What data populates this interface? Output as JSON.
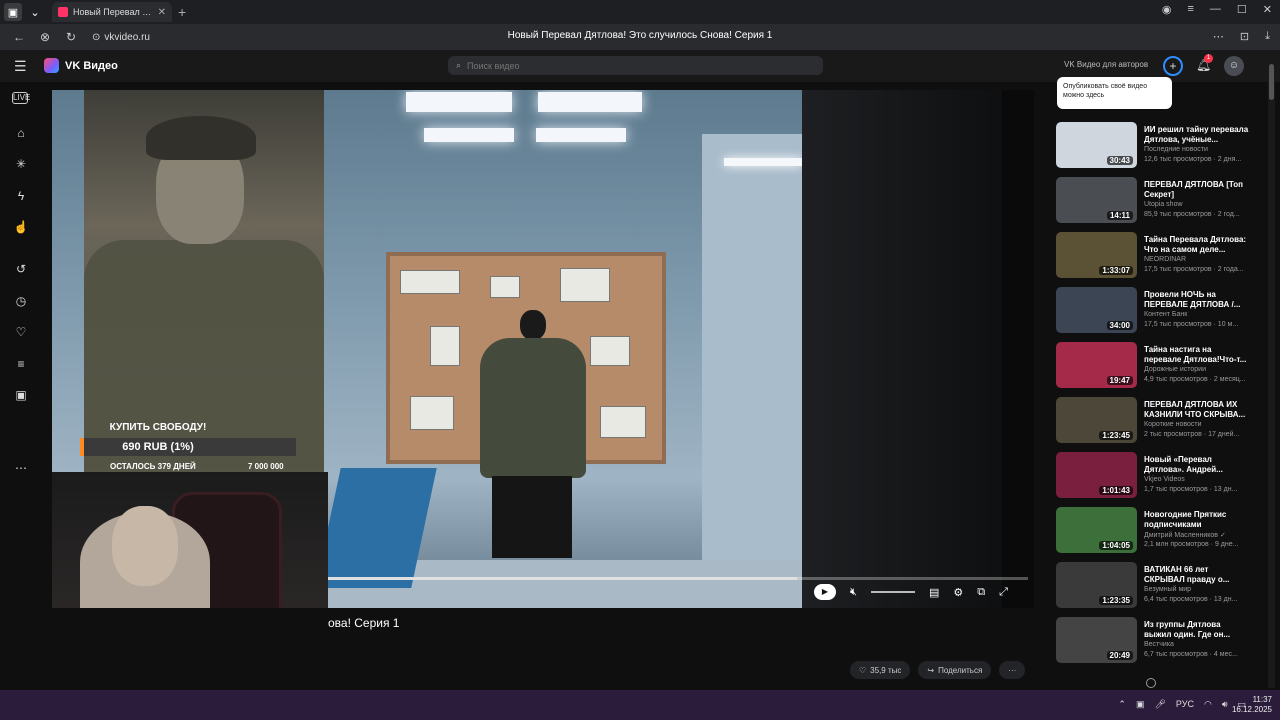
{
  "browser": {
    "tab_title": "Новый Перевал Дятлова!",
    "tab_close": "✕",
    "new_tab": "+",
    "url": "vkvideo.ru",
    "page_title": "Новый Перевал Дятлова! Это случилось Снова! Серия 1",
    "window_controls": [
      "—",
      "☐",
      "✕"
    ]
  },
  "header": {
    "logo": "VK Видео",
    "search_placeholder": "Поиск видео",
    "authors_link": "VK Видео для авторов",
    "notif_count": "1",
    "publish_tooltip": "Опубликовать своё видео можно здесь"
  },
  "player": {
    "donation": {
      "label": "КУПИТЬ СВОБОДУ!",
      "amount": "690 RUB (1%)",
      "days_left": "ОСТАЛОСЬ 379 ДНЕЙ",
      "goal": "7 000 000",
      "progress": 0.01
    },
    "progress": 0.67
  },
  "video": {
    "title_visible": "ова! Серия 1",
    "likes": "35,9 тыс",
    "share": "Поделиться",
    "more": "···"
  },
  "sidebar": {
    "videos": [
      {
        "title": "ИИ решил тайну перевала Дятлова, учёные...",
        "channel": "Последние новости",
        "meta": "12,6 тыс просмотров · 2 дня...",
        "duration": "30:43",
        "color": "#cfd6dd"
      },
      {
        "title": "ПЕРЕВАЛ ДЯТЛОВА [Топ Секрет]",
        "channel": "Utopia show",
        "meta": "85,9 тыс просмотров · 2 год...",
        "duration": "14:11",
        "color": "#4a4d52"
      },
      {
        "title": "Тайна Перевала Дятлова: Что на самом деле...",
        "channel": "NEORDINAR",
        "meta": "17,5 тыс просмотров · 2 года...",
        "duration": "1:33:07",
        "color": "#5b5134"
      },
      {
        "title": "Провели НОЧЬ на ПЕРЕВАЛЕ ДЯТЛОВА /...",
        "channel": "Контент Банк",
        "meta": "17,5 тыс просмотров · 10 м...",
        "duration": "34:00",
        "color": "#3b4554"
      },
      {
        "title": "Тайна настига на перевале Дятлова!Что-т...",
        "channel": "Дорожные истории",
        "meta": "4,9 тыс просмотров · 2 месяц...",
        "duration": "19:47",
        "color": "#a52a4a"
      },
      {
        "title": "ПЕРЕВАЛ ДЯТЛОВА ИХ КАЗНИЛИ ЧТО СКРЫВА...",
        "channel": "Короткие новости",
        "meta": "2 тыс просмотров · 17 дней...",
        "duration": "1:23:45",
        "color": "#4c4738"
      },
      {
        "title": "Новый «Перевал Дятлова». Андрей...",
        "channel": "Vkjeo Videos",
        "meta": "1,7 тыс просмотров · 13 дн...",
        "duration": "1:01:43",
        "color": "#7a1f3d"
      },
      {
        "title": "Новогодние Пряткиc подписчиками",
        "channel": "Дмитрий Масленников ✓",
        "meta": "2,1 млн просмотров · 9 дне...",
        "duration": "1:04:05",
        "color": "#3d6f3a"
      },
      {
        "title": "ВАТИКАН 66 лет СКРЫВАЛ правду о...",
        "channel": "Безумный мир",
        "meta": "6,4 тыс просмотров · 13 дн...",
        "duration": "1:23:35",
        "color": "#3a3a3a"
      },
      {
        "title": "Из группы Дятлова выжил один. Где он...",
        "channel": "Вестчика",
        "meta": "6,7 тыс просмотров · 4 мес...",
        "duration": "20:49",
        "color": "#444"
      }
    ]
  },
  "taskbar": {
    "lang": "РУС",
    "time": "11:37",
    "date": "16.12.2025"
  }
}
